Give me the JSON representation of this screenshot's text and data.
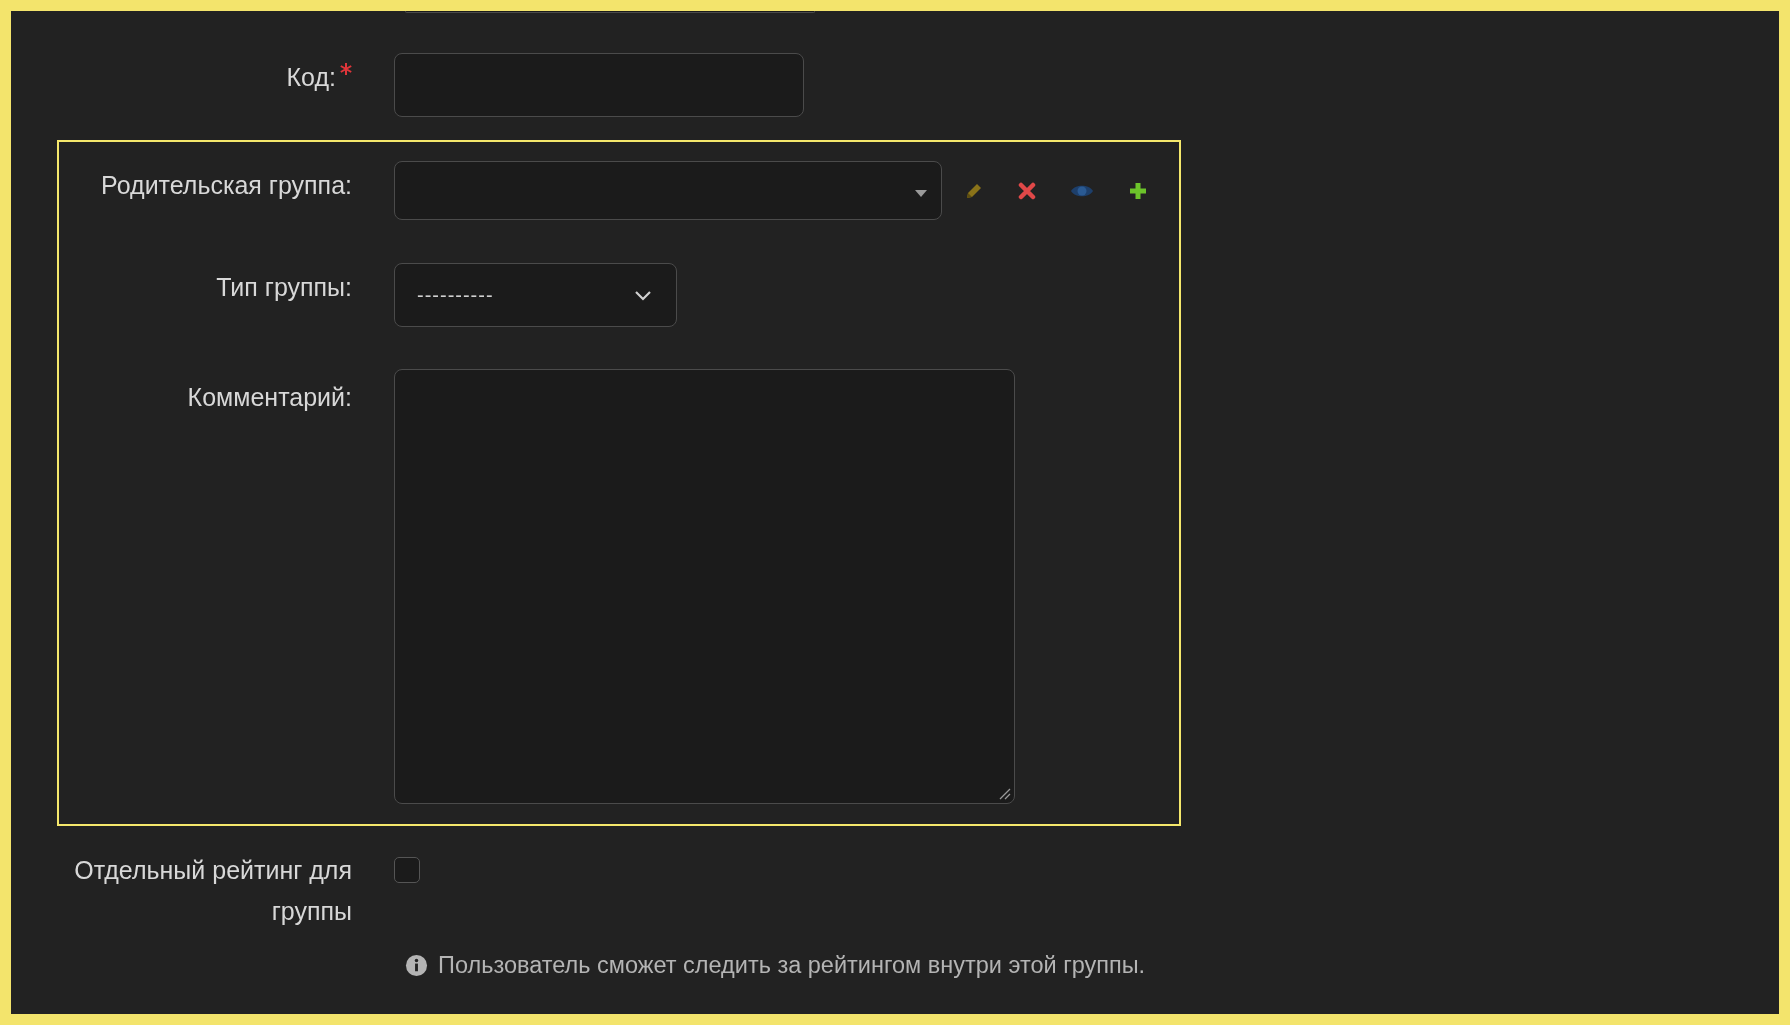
{
  "fields": [
    {
      "kind": "cut"
    },
    {
      "kind": "text",
      "label": "Код:",
      "required": true
    }
  ],
  "group_box": {
    "highlighted": true,
    "fields": [
      {
        "kind": "lookup",
        "label": "Родительская группа:",
        "required": false
      },
      {
        "kind": "select",
        "label": "Тип группы:",
        "value": "----------",
        "required": false
      },
      {
        "kind": "textarea",
        "label": "Комментарий:",
        "required": false
      }
    ]
  },
  "options": [
    {
      "kind": "checkbox",
      "label": "Отдельный рейтинг для группы",
      "checked": false
    }
  ],
  "help": "Пользователь сможет следить за рейтингом внутри этой группы."
}
